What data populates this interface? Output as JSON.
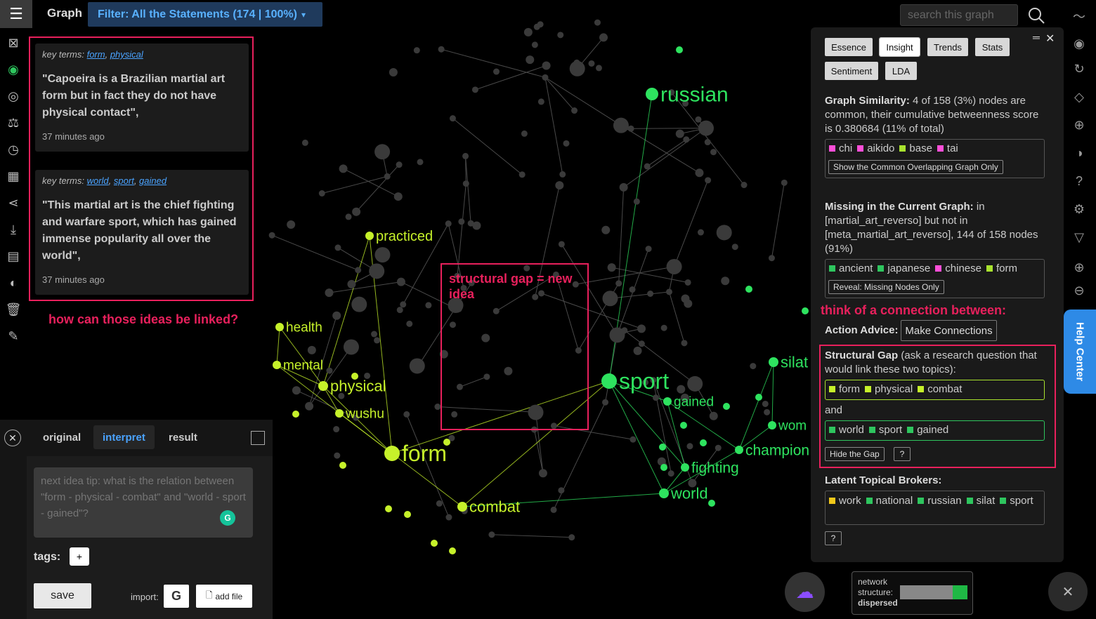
{
  "topbar": {
    "title": "Graph",
    "filter_label": "Filter: All the Statements (174 | 100%)",
    "filter_caret": "▾",
    "search_placeholder": "search this graph"
  },
  "statements": [
    {
      "terms_prefix": "key terms:",
      "terms": [
        "form",
        "physical"
      ],
      "quote": "\"Capoeira is a Brazilian martial art form but in fact they do not have physical contact\",",
      "time": "37 minutes ago"
    },
    {
      "terms_prefix": "key terms:",
      "terms": [
        "world",
        "sport",
        "gained"
      ],
      "quote": "\"This martial art is the chief fighting and warfare sport, which has gained immense popularity all over the world\",",
      "time": "37 minutes ago"
    }
  ],
  "annotations": {
    "linked_question": "how can those ideas be linked?",
    "structural_gap": "structural gap = new idea",
    "think_connection": "think of a connection between:"
  },
  "interpret": {
    "tabs": [
      "original",
      "interpret",
      "result"
    ],
    "active_tab": "interpret",
    "textarea_placeholder": "next idea tip: what is the relation between \"form - physical - combat\" and \"world - sport - gained\"?",
    "grammarly_glyph": "G",
    "tags_label": "tags:",
    "tags_add": "+",
    "save": "save",
    "import_label": "import:",
    "google_glyph": "G",
    "add_file": "add file"
  },
  "graph": {
    "labels": [
      {
        "text": "russian",
        "color": "#2ee35f"
      },
      {
        "text": "practiced",
        "color": "#c6f12a"
      },
      {
        "text": "health",
        "color": "#c6f12a"
      },
      {
        "text": "mental",
        "color": "#c6f12a"
      },
      {
        "text": "physical",
        "color": "#c6f12a"
      },
      {
        "text": "wushu",
        "color": "#c6f12a"
      },
      {
        "text": "form",
        "color": "#c6f12a"
      },
      {
        "text": "combat",
        "color": "#c6f12a"
      },
      {
        "text": "sport",
        "color": "#2ee35f"
      },
      {
        "text": "gained",
        "color": "#2ee35f"
      },
      {
        "text": "fighting",
        "color": "#2ee35f"
      },
      {
        "text": "world",
        "color": "#2ee35f"
      },
      {
        "text": "champion",
        "color": "#2ee35f"
      },
      {
        "text": "silat",
        "color": "#2ee35f"
      },
      {
        "text": "wom",
        "color": "#2ee35f"
      }
    ]
  },
  "insight": {
    "tabs": [
      "Essence",
      "Insight",
      "Trends",
      "Stats",
      "Sentiment",
      "LDA"
    ],
    "active_tab": "Insight",
    "similarity_title": "Graph Similarity:",
    "similarity_text": "4 of 158 (3%) nodes are common, their cumulative betweenness score is 0.380684 (11% of total)",
    "common_terms": [
      {
        "label": "chi",
        "color": "#ff4fd8"
      },
      {
        "label": "aikido",
        "color": "#ff4fd8"
      },
      {
        "label": "base",
        "color": "#a8e22e"
      },
      {
        "label": "tai",
        "color": "#ff4fd8"
      }
    ],
    "common_button": "Show the Common Overlapping Graph Only",
    "missing_title": "Missing in the Current Graph:",
    "missing_text": "in [martial_art_reverso] but not in [meta_martial_art_reverso], 144 of 158 nodes (91%)",
    "missing_terms": [
      {
        "label": "ancient",
        "color": "#2ec55e"
      },
      {
        "label": "japanese",
        "color": "#2ec55e"
      },
      {
        "label": "chinese",
        "color": "#ff4fd8"
      },
      {
        "label": "form",
        "color": "#a8e22e"
      }
    ],
    "missing_button": "Reveal: Missing Nodes Only",
    "action_label": "Action Advice:",
    "make_connections": "Make Connections",
    "gap_title": "Structural Gap",
    "gap_text": "(ask a research question that would link these two topics):",
    "gap_group1": [
      {
        "label": "form",
        "color": "#c6f12a"
      },
      {
        "label": "physical",
        "color": "#c6f12a"
      },
      {
        "label": "combat",
        "color": "#c6f12a"
      }
    ],
    "gap_and": "and",
    "gap_group2": [
      {
        "label": "world",
        "color": "#2ec55e"
      },
      {
        "label": "sport",
        "color": "#2ec55e"
      },
      {
        "label": "gained",
        "color": "#2ec55e"
      }
    ],
    "hide_gap": "Hide the Gap",
    "question": "?",
    "brokers_title": "Latent Topical Brokers:",
    "brokers": [
      {
        "label": "work",
        "color": "#f2c81a"
      },
      {
        "label": "national",
        "color": "#2ec55e"
      },
      {
        "label": "russian",
        "color": "#2ec55e"
      },
      {
        "label": "silat",
        "color": "#2ec55e"
      },
      {
        "label": "sport",
        "color": "#2ec55e"
      }
    ]
  },
  "help_center": "Help Center",
  "network": {
    "label_line1": "network",
    "label_line2": "structure:",
    "state": "dispersed",
    "level": 0.22
  }
}
